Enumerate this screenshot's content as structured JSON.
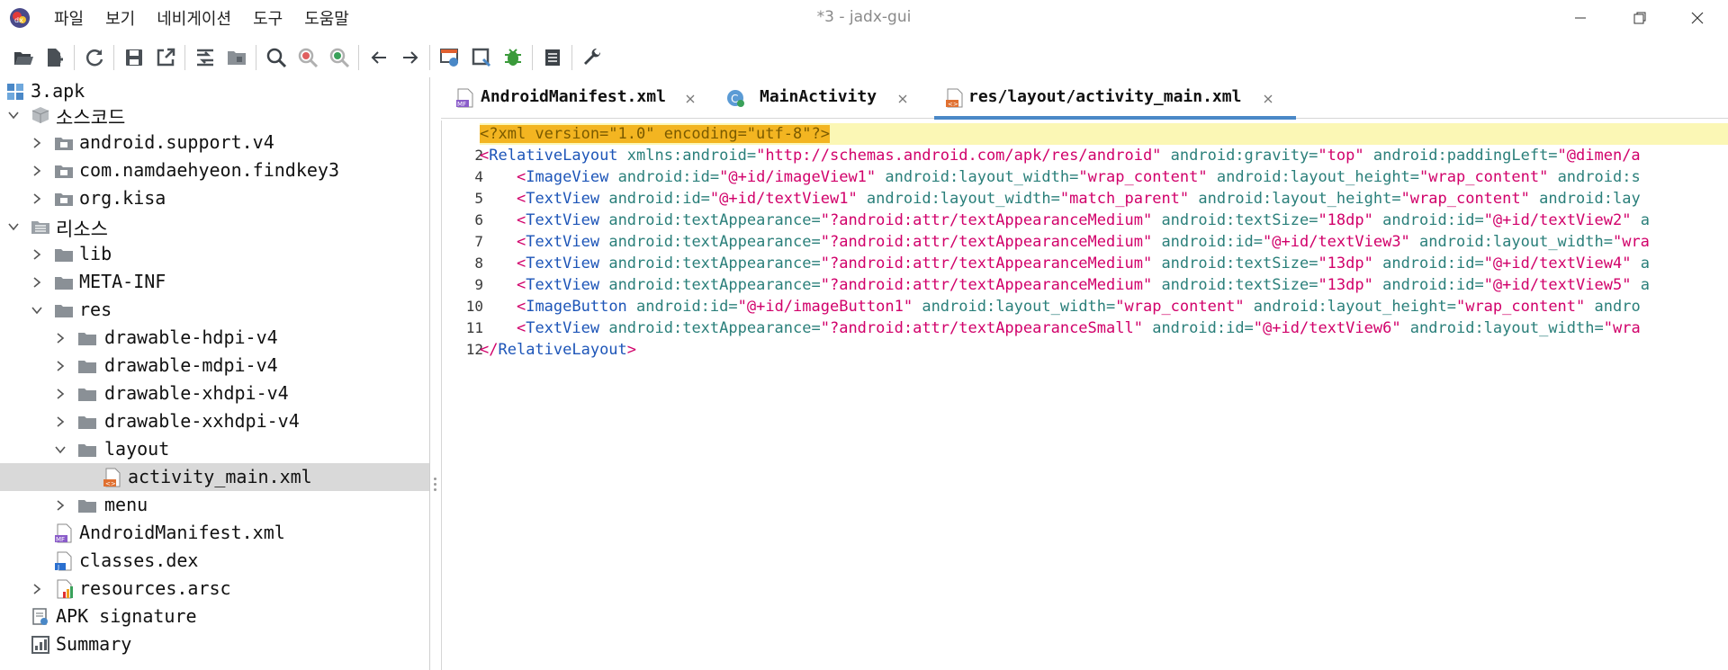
{
  "window": {
    "title": "*3 - jadx-gui",
    "menu": [
      "파일",
      "보기",
      "네비게이션",
      "도구",
      "도움말"
    ]
  },
  "toolbar": {
    "buttons": [
      "open-icon",
      "add-files-icon",
      "refresh-icon",
      "save-icon",
      "export-icon",
      "sync-icon",
      "flatten-icon",
      "search-icon",
      "find-class-icon",
      "find-usage-icon",
      "back-icon",
      "forward-icon",
      "decompile-icon",
      "quark-icon",
      "debug-icon",
      "log-icon",
      "preferences-icon"
    ]
  },
  "tree": {
    "items": [
      {
        "label": "3.apk",
        "level": 0,
        "expander": "none",
        "icon": "apk-icon"
      },
      {
        "label": "소스코드",
        "level": 0,
        "expander": "expanded",
        "icon": "package-icon"
      },
      {
        "label": "android.support.v4",
        "level": 1,
        "expander": "collapsed",
        "icon": "pkg-folder-icon"
      },
      {
        "label": "com.namdaehyeon.findkey3",
        "level": 1,
        "expander": "collapsed",
        "icon": "pkg-folder-icon"
      },
      {
        "label": "org.kisa",
        "level": 1,
        "expander": "collapsed",
        "icon": "pkg-folder-icon"
      },
      {
        "label": "리소스",
        "level": 0,
        "expander": "expanded",
        "icon": "resources-icon"
      },
      {
        "label": "lib",
        "level": 1,
        "expander": "collapsed",
        "icon": "folder-icon"
      },
      {
        "label": "META-INF",
        "level": 1,
        "expander": "collapsed",
        "icon": "folder-icon"
      },
      {
        "label": "res",
        "level": 1,
        "expander": "expanded",
        "icon": "folder-icon"
      },
      {
        "label": "drawable-hdpi-v4",
        "level": 2,
        "expander": "collapsed",
        "icon": "folder-icon"
      },
      {
        "label": "drawable-mdpi-v4",
        "level": 2,
        "expander": "collapsed",
        "icon": "folder-icon"
      },
      {
        "label": "drawable-xhdpi-v4",
        "level": 2,
        "expander": "collapsed",
        "icon": "folder-icon"
      },
      {
        "label": "drawable-xxhdpi-v4",
        "level": 2,
        "expander": "collapsed",
        "icon": "folder-icon"
      },
      {
        "label": "layout",
        "level": 2,
        "expander": "expanded",
        "icon": "folder-icon"
      },
      {
        "label": "activity_main.xml",
        "level": 3,
        "expander": "none",
        "icon": "xml-file-icon",
        "selected": true
      },
      {
        "label": "menu",
        "level": 2,
        "expander": "collapsed",
        "icon": "folder-icon"
      },
      {
        "label": "AndroidManifest.xml",
        "level": 1,
        "expander": "none",
        "icon": "manifest-icon"
      },
      {
        "label": "classes.dex",
        "level": 1,
        "expander": "none",
        "icon": "dex-icon"
      },
      {
        "label": "resources.arsc",
        "level": 1,
        "expander": "collapsed",
        "icon": "arsc-icon"
      },
      {
        "label": "APK signature",
        "level": 0,
        "expander": "none",
        "icon": "signature-icon"
      },
      {
        "label": "Summary",
        "level": 0,
        "expander": "none",
        "icon": "summary-icon"
      }
    ]
  },
  "tabs": [
    {
      "label": "AndroidManifest.xml",
      "icon": "manifest-icon",
      "active": false
    },
    {
      "label": "MainActivity",
      "icon": "class-icon",
      "active": false
    },
    {
      "label": "res/layout/activity_main.xml",
      "icon": "xml-file-icon",
      "active": true
    }
  ],
  "editor": {
    "line_numbers": [
      "",
      "2",
      "4",
      "5",
      "6",
      "7",
      "8",
      "9",
      "10",
      "11",
      "12"
    ],
    "lines": [
      [
        {
          "k": "pi",
          "s": "<?xml version=\"1.0\" encoding=\"utf-8\"?>"
        }
      ],
      [
        {
          "k": "p",
          "s": "<"
        },
        {
          "k": "t",
          "s": "RelativeLayout"
        },
        {
          "k": "a",
          "s": " xmlns:android="
        },
        {
          "k": "v",
          "s": "\"http://schemas.android.com/apk/res/android\""
        },
        {
          "k": "a",
          "s": " android:gravity="
        },
        {
          "k": "v",
          "s": "\"top\""
        },
        {
          "k": "a",
          "s": " android:paddingLeft="
        },
        {
          "k": "v",
          "s": "\"@dimen/a"
        }
      ],
      [
        {
          "k": "a",
          "s": "    "
        },
        {
          "k": "p",
          "s": "<"
        },
        {
          "k": "t",
          "s": "ImageView"
        },
        {
          "k": "a",
          "s": " android:id="
        },
        {
          "k": "v",
          "s": "\"@+id/imageView1\""
        },
        {
          "k": "a",
          "s": " android:layout_width="
        },
        {
          "k": "v",
          "s": "\"wrap_content\""
        },
        {
          "k": "a",
          "s": " android:layout_height="
        },
        {
          "k": "v",
          "s": "\"wrap_content\""
        },
        {
          "k": "a",
          "s": " android:s"
        }
      ],
      [
        {
          "k": "a",
          "s": "    "
        },
        {
          "k": "p",
          "s": "<"
        },
        {
          "k": "t",
          "s": "TextView"
        },
        {
          "k": "a",
          "s": " android:id="
        },
        {
          "k": "v",
          "s": "\"@+id/textView1\""
        },
        {
          "k": "a",
          "s": " android:layout_width="
        },
        {
          "k": "v",
          "s": "\"match_parent\""
        },
        {
          "k": "a",
          "s": " android:layout_height="
        },
        {
          "k": "v",
          "s": "\"wrap_content\""
        },
        {
          "k": "a",
          "s": " android:lay"
        }
      ],
      [
        {
          "k": "a",
          "s": "    "
        },
        {
          "k": "p",
          "s": "<"
        },
        {
          "k": "t",
          "s": "TextView"
        },
        {
          "k": "a",
          "s": " android:textAppearance="
        },
        {
          "k": "v",
          "s": "\"?android:attr/textAppearanceMedium\""
        },
        {
          "k": "a",
          "s": " android:textSize="
        },
        {
          "k": "v",
          "s": "\"18dp\""
        },
        {
          "k": "a",
          "s": " android:id="
        },
        {
          "k": "v",
          "s": "\"@+id/textView2\""
        },
        {
          "k": "a",
          "s": " a"
        }
      ],
      [
        {
          "k": "a",
          "s": "    "
        },
        {
          "k": "p",
          "s": "<"
        },
        {
          "k": "t",
          "s": "TextView"
        },
        {
          "k": "a",
          "s": " android:textAppearance="
        },
        {
          "k": "v",
          "s": "\"?android:attr/textAppearanceMedium\""
        },
        {
          "k": "a",
          "s": " android:id="
        },
        {
          "k": "v",
          "s": "\"@+id/textView3\""
        },
        {
          "k": "a",
          "s": " android:layout_width="
        },
        {
          "k": "v",
          "s": "\"wra"
        }
      ],
      [
        {
          "k": "a",
          "s": "    "
        },
        {
          "k": "p",
          "s": "<"
        },
        {
          "k": "t",
          "s": "TextView"
        },
        {
          "k": "a",
          "s": " android:textAppearance="
        },
        {
          "k": "v",
          "s": "\"?android:attr/textAppearanceMedium\""
        },
        {
          "k": "a",
          "s": " android:textSize="
        },
        {
          "k": "v",
          "s": "\"13dp\""
        },
        {
          "k": "a",
          "s": " android:id="
        },
        {
          "k": "v",
          "s": "\"@+id/textView4\""
        },
        {
          "k": "a",
          "s": " a"
        }
      ],
      [
        {
          "k": "a",
          "s": "    "
        },
        {
          "k": "p",
          "s": "<"
        },
        {
          "k": "t",
          "s": "TextView"
        },
        {
          "k": "a",
          "s": " android:textAppearance="
        },
        {
          "k": "v",
          "s": "\"?android:attr/textAppearanceMedium\""
        },
        {
          "k": "a",
          "s": " android:textSize="
        },
        {
          "k": "v",
          "s": "\"13dp\""
        },
        {
          "k": "a",
          "s": " android:id="
        },
        {
          "k": "v",
          "s": "\"@+id/textView5\""
        },
        {
          "k": "a",
          "s": " a"
        }
      ],
      [
        {
          "k": "a",
          "s": "    "
        },
        {
          "k": "p",
          "s": "<"
        },
        {
          "k": "t",
          "s": "ImageButton"
        },
        {
          "k": "a",
          "s": " android:id="
        },
        {
          "k": "v",
          "s": "\"@+id/imageButton1\""
        },
        {
          "k": "a",
          "s": " android:layout_width="
        },
        {
          "k": "v",
          "s": "\"wrap_content\""
        },
        {
          "k": "a",
          "s": " android:layout_height="
        },
        {
          "k": "v",
          "s": "\"wrap_content\""
        },
        {
          "k": "a",
          "s": " andro"
        }
      ],
      [
        {
          "k": "a",
          "s": "    "
        },
        {
          "k": "p",
          "s": "<"
        },
        {
          "k": "t",
          "s": "TextView"
        },
        {
          "k": "a",
          "s": " android:textAppearance="
        },
        {
          "k": "v",
          "s": "\"?android:attr/textAppearanceSmall\""
        },
        {
          "k": "a",
          "s": " android:id="
        },
        {
          "k": "v",
          "s": "\"@+id/textView6\""
        },
        {
          "k": "a",
          "s": " android:layout_width="
        },
        {
          "k": "v",
          "s": "\"wra"
        }
      ],
      [
        {
          "k": "p",
          "s": "</"
        },
        {
          "k": "t",
          "s": "RelativeLayout"
        },
        {
          "k": "p",
          "s": ">"
        }
      ]
    ]
  },
  "colors": {
    "accent": "#4a88c7",
    "tag": "#1d55b8",
    "attribute": "#2a7f7a",
    "value": "#d1006a",
    "line_highlight": "#fbf7b5",
    "selection": "#d9d9d9"
  }
}
